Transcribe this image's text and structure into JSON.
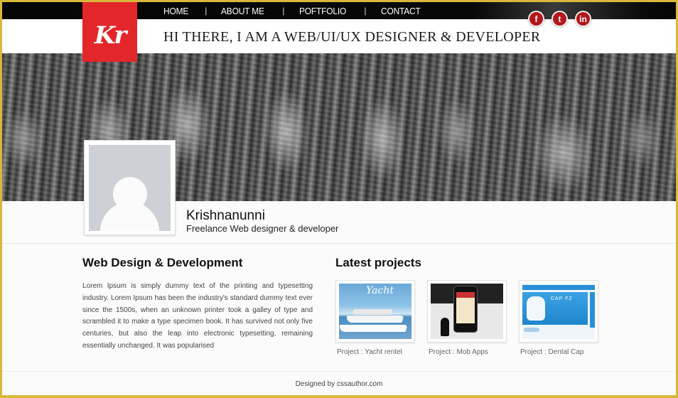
{
  "nav": {
    "items": [
      {
        "label": "HOME"
      },
      {
        "label": "ABOUT ME"
      },
      {
        "label": "POFTFOLIO"
      },
      {
        "label": "CONTACT"
      }
    ],
    "separator": "|"
  },
  "social": [
    {
      "name": "facebook-icon",
      "glyph": "f"
    },
    {
      "name": "twitter-icon",
      "glyph": "t"
    },
    {
      "name": "linkedin-icon",
      "glyph": "in"
    }
  ],
  "logo": {
    "text": "Kr",
    "color": "#e3262a"
  },
  "header": {
    "tagline": "HI THERE,  I AM A WEB/UI/UX DESIGNER & DEVELOPER"
  },
  "profile": {
    "name": "Krishnanunni",
    "role": "Freelance Web designer & developer"
  },
  "about": {
    "title": "Web Design & Development",
    "text": "Lorem Ipsum is simply dummy text of the printing and typesetting industry. Lorem Ipsum has been the industry's standard dummy text ever since the 1500s, when an unknown printer took a galley of type and scrambled it to make a type specimen book. It has survived not only five centuries, but also the leap into electronic typesetting, remaining essentially unchanged. It was popularised"
  },
  "projects": {
    "title": "Latest projects",
    "items": [
      {
        "caption": "Project : Yacht rentel",
        "thumb_text": "Yacht"
      },
      {
        "caption": "Project : Mob Apps"
      },
      {
        "caption": "Project : Dental Cap",
        "thumb_text": "CAP FZ"
      }
    ]
  },
  "footer": {
    "text": "Designed by cssauthor.com"
  },
  "colors": {
    "frame": "#d8b838",
    "accent": "#e3262a",
    "social": "#b3161b"
  }
}
